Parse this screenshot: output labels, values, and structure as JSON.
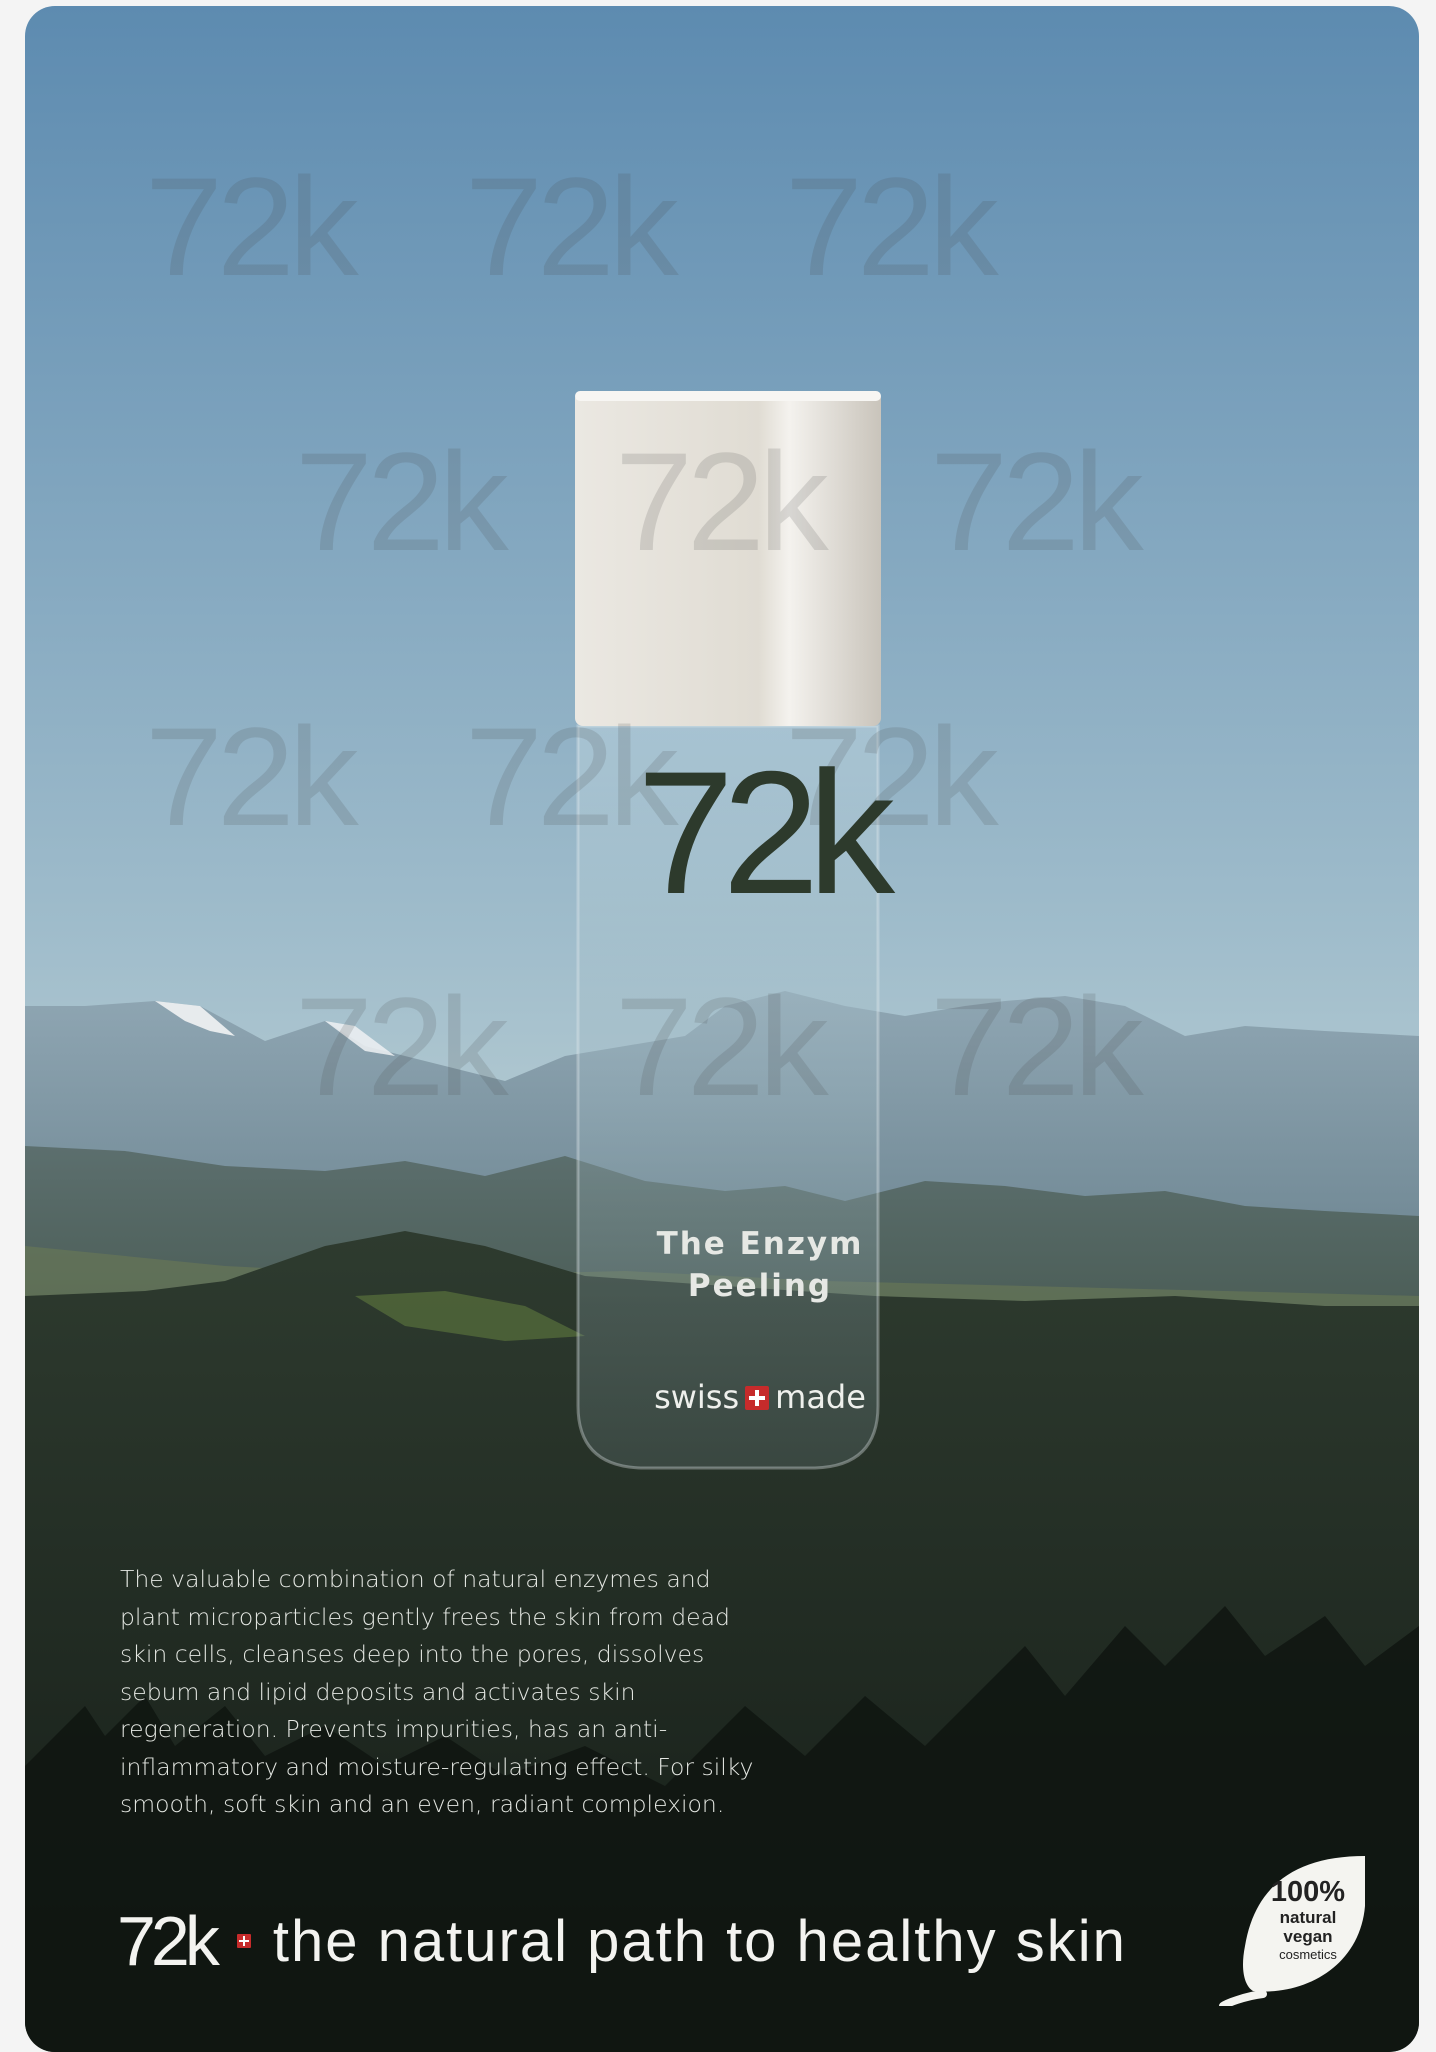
{
  "watermark_text": "72k",
  "bottle": {
    "logo": "72k",
    "product_name_line1": "The Enzym",
    "product_name_line2": "Peeling",
    "swiss": "swiss",
    "made": "made"
  },
  "description": "The valuable combination of natural enzymes and plant microparticles gently frees the skin from dead skin cells, cleanses deep into the pores, dissolves sebum and lipid deposits and activates skin regeneration. Prevents impurities, has an anti-inflammatory and moisture-regulating effect. For silky smooth, soft skin and an even, radiant complexion.",
  "tagline": {
    "logo": "72k",
    "slogan": "the natural path to healthy skin"
  },
  "badge": {
    "percent": "100%",
    "line1": "natural",
    "line2": "vegan",
    "line3": "cosmetics"
  },
  "colors": {
    "sky_top": "#5e8cb1",
    "sky_bottom": "#dfe7de",
    "swiss_red": "#c62b2b",
    "forest": "#1f2a22"
  }
}
